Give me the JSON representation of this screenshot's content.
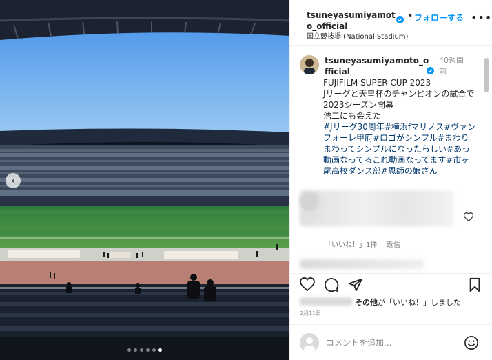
{
  "post": {
    "photo_alt": "",
    "carousel": {
      "count": 6,
      "active_index": 5
    }
  },
  "header": {
    "username": "tsuneyasumiyamoto_official",
    "separator": "•",
    "follow_label": "フォローする",
    "more_label": "•••",
    "location": "国立競技場 (National Stadium)"
  },
  "caption": {
    "username": "tsuneyasumiyamoto_official",
    "time_ago": "40週間前",
    "text": "FUJIFILM SUPER CUP 2023\nJリーグと天皇杯のチャンピオンの試合で2023シーズン開幕\n浩二にも会えた",
    "hashtags": "#Jリーグ30周年#横浜fマリノス#ヴァンフォーレ甲府#ロゴがシンプル#まわりまわってシンプルになったらしい#あっ動画なってるこれ動画なってます#市ヶ尾高校ダンス部#恩師の娘さん"
  },
  "comment": {
    "likes_label": "「いいね！」1件",
    "reply_label": "返信"
  },
  "likes": {
    "others_label": "その他",
    "suffix": "が「いいね！」しました"
  },
  "date": "2月11日",
  "comment_input": {
    "placeholder": "コメントを追加..."
  },
  "colors": {
    "follow_blue": "#0095f6",
    "hashtag_blue": "#00376b",
    "verified_blue": "#0095f6"
  },
  "icons": [
    "chevron-left-icon",
    "verified-icon",
    "more-icon",
    "heart-icon",
    "comment-icon",
    "share-icon",
    "bookmark-icon",
    "emoji-icon"
  ]
}
